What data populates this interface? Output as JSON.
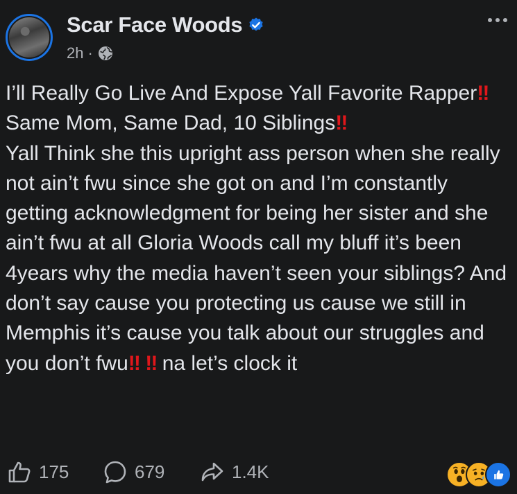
{
  "author": {
    "name": "Scar Face Woods",
    "time": "2h",
    "separator": "·",
    "verified": true,
    "audience_icon": "globe-icon"
  },
  "post": {
    "segments": [
      {
        "text": "I’ll Really Go Live And Expose Yall Favorite Rapper",
        "emph": false
      },
      {
        "text": "‼",
        "emph": true
      },
      {
        "text": " Same Mom, Same Dad, 10 Siblings",
        "emph": false
      },
      {
        "text": "‼",
        "emph": true
      },
      {
        "text": "\nYall Think she this upright ass person when she really not ain’t fwu since she got on and I’m constantly getting acknowledgment for being her sister and she ain’t fwu at all Gloria Woods call my bluff it’s been 4years why the media haven’t seen your siblings? And don’t say cause you protecting us cause we still in Memphis it’s cause you talk about our struggles and you don’t fwu",
        "emph": false
      },
      {
        "text": "‼",
        "emph": true
      },
      {
        "text": " ",
        "emph": false
      },
      {
        "text": "‼",
        "emph": true
      },
      {
        "text": " na let’s clock it",
        "emph": false
      }
    ]
  },
  "actions": {
    "like_count": "175",
    "comment_count": "679",
    "share_count": "1.4K"
  },
  "reactions": [
    "wow-reaction",
    "sad-reaction",
    "like-reaction"
  ],
  "colors": {
    "background": "#18191a",
    "text": "#e4e6eb",
    "muted": "#b0b3b8",
    "accent": "#1b74e4",
    "emphasis": "#e0171b"
  }
}
